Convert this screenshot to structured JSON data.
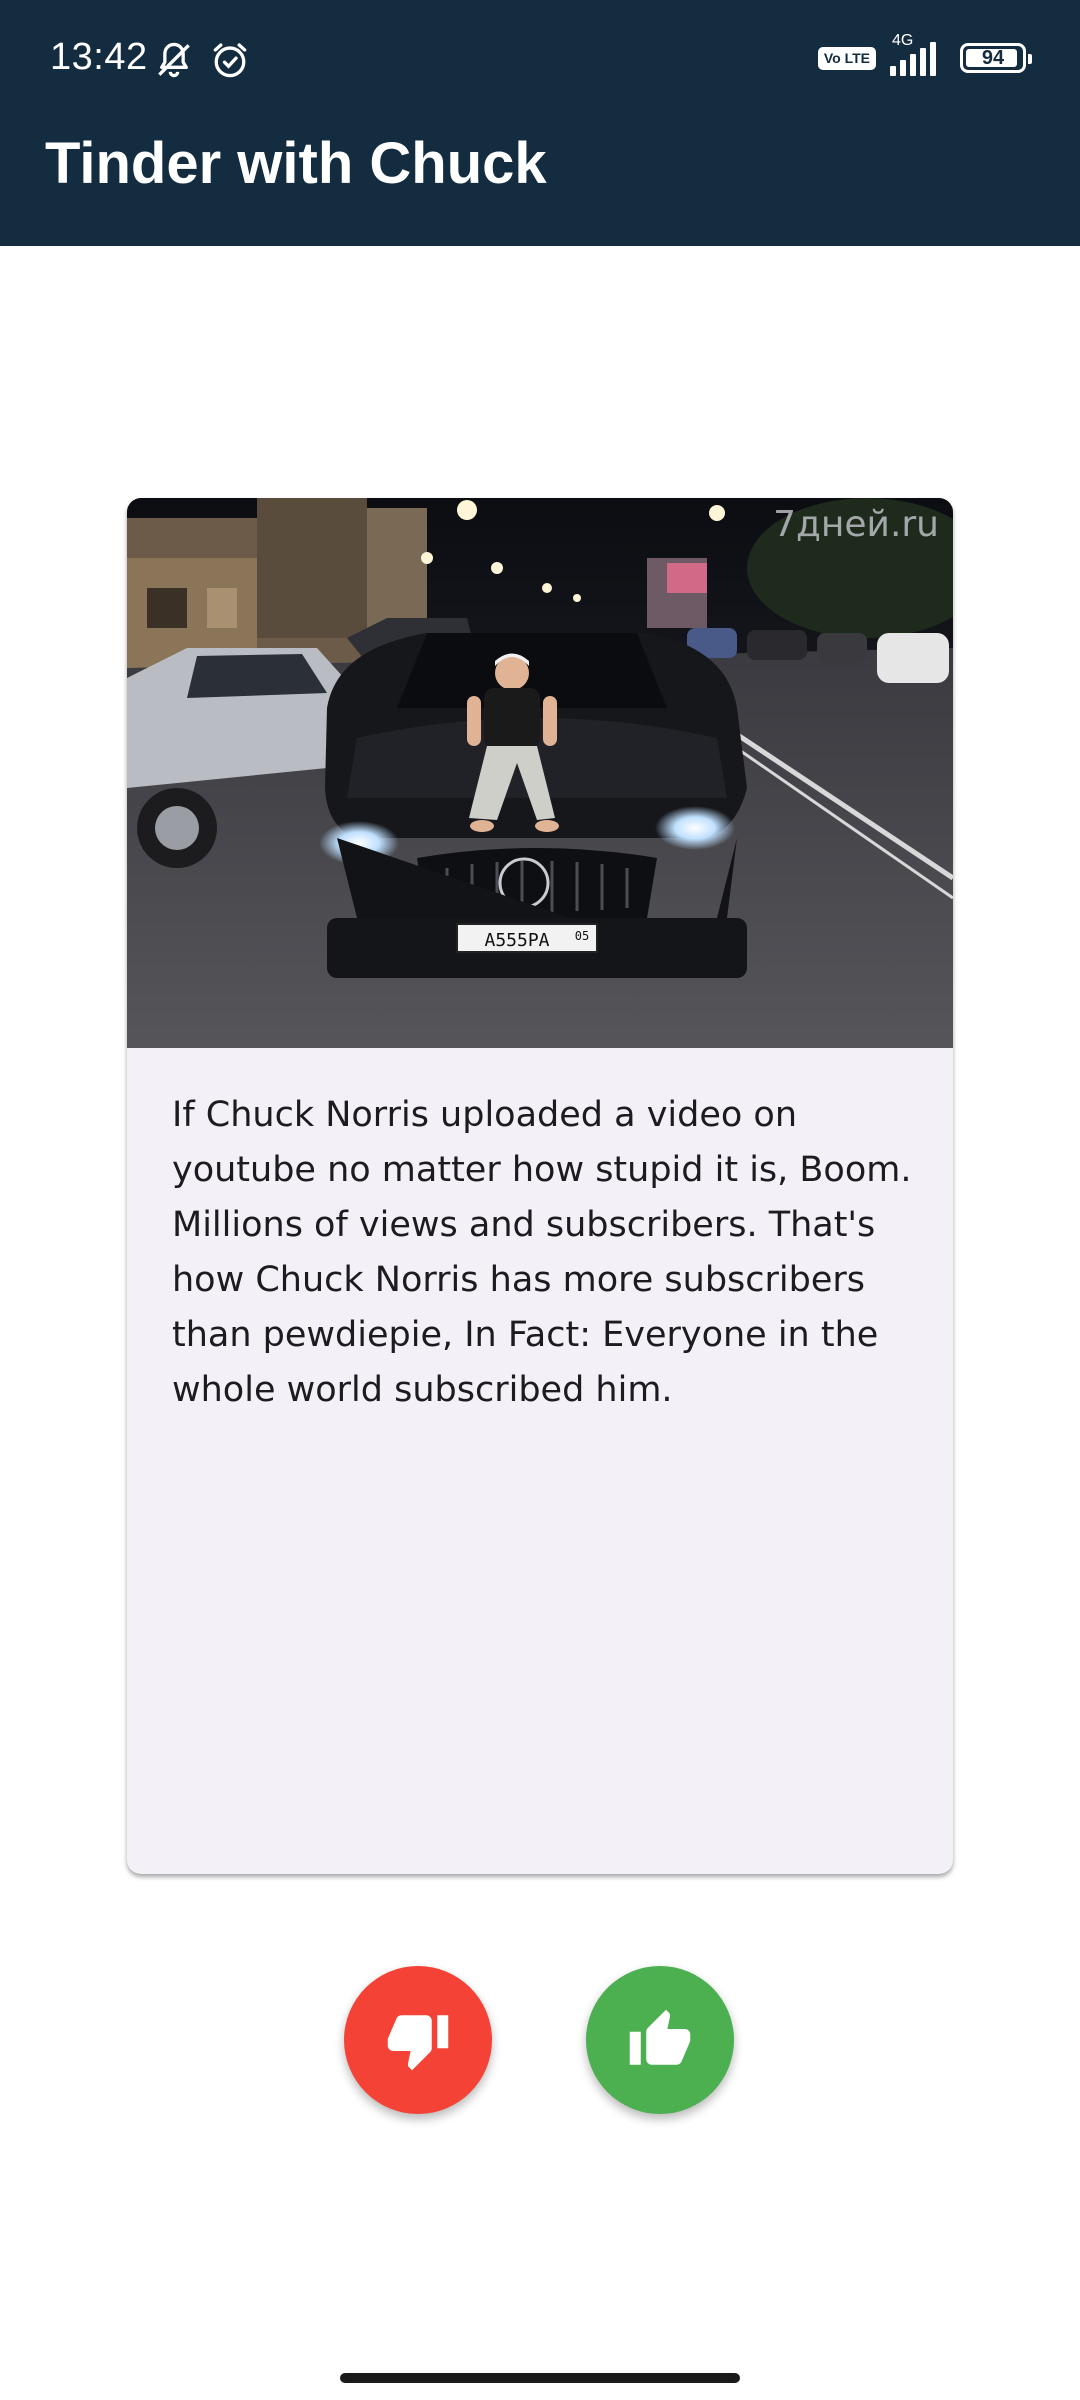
{
  "status_bar": {
    "time": "13:42",
    "volte_label": "Vo LTE",
    "network_type": "4G",
    "battery_level": "94",
    "battery_fraction": 0.94,
    "icons": [
      "bell-off-icon",
      "alarm-icon",
      "volte-icon",
      "signal-icon",
      "battery-icon"
    ]
  },
  "app_bar": {
    "title": "Tinder with Chuck",
    "background_color": "#142c40"
  },
  "card": {
    "image_watermark": "7дней.ru",
    "plate_text": "A555PA",
    "plate_region": "05",
    "joke_text": "If Chuck Norris uploaded a video on youtube no matter how stupid it is, Boom. Millions of views and subscribers. That's how Chuck Norris has more subscribers than pewdiepie, In Fact: Everyone in the whole world subscribed him.",
    "background_color": "#f4f0f8"
  },
  "actions": {
    "dislike_icon": "thumb-down-icon",
    "dislike_color": "#f44336",
    "like_icon": "thumb-up-icon",
    "like_color": "#4caf50"
  }
}
